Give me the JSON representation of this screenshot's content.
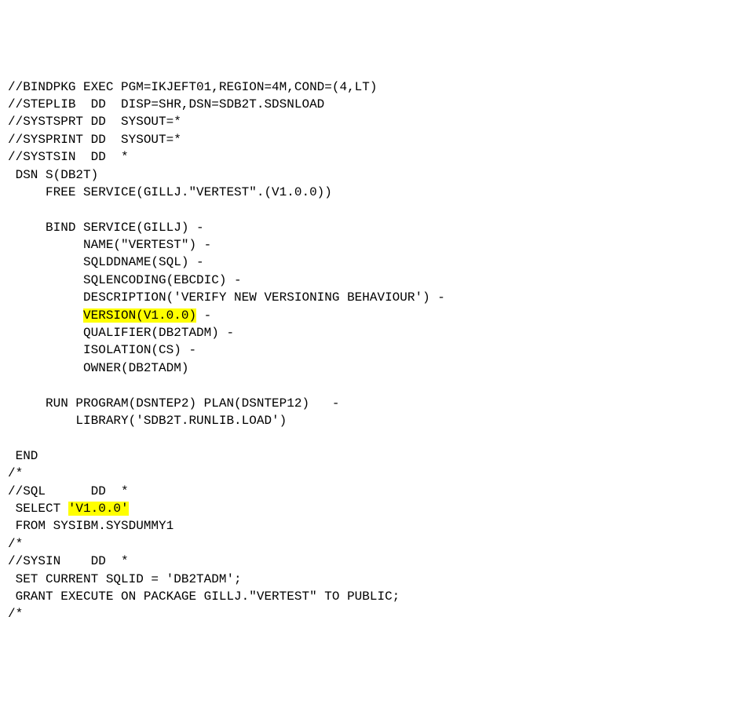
{
  "lines": {
    "l1": "//BINDPKG EXEC PGM=IKJEFT01,REGION=4M,COND=(4,LT)",
    "l2": "//STEPLIB  DD  DISP=SHR,DSN=SDB2T.SDSNLOAD",
    "l3": "//SYSTSPRT DD  SYSOUT=*",
    "l4": "//SYSPRINT DD  SYSOUT=*",
    "l5": "//SYSTSIN  DD  *",
    "l6": " DSN S(DB2T)",
    "l7": "     FREE SERVICE(GILLJ.\"VERTEST\".(V1.0.0))",
    "l8": "",
    "l9": "     BIND SERVICE(GILLJ) -",
    "l10": "          NAME(\"VERTEST\") -",
    "l11": "          SQLDDNAME(SQL) -",
    "l12": "          SQLENCODING(EBCDIC) -",
    "l13": "          DESCRIPTION('VERIFY NEW VERSIONING BEHAVIOUR') -",
    "l14a": "          ",
    "l14b": "VERSION(V1.0.0)",
    "l14c": " -",
    "l15": "          QUALIFIER(DB2TADM) -",
    "l16": "          ISOLATION(CS) -",
    "l17": "          OWNER(DB2TADM)",
    "l18": "",
    "l19": "     RUN PROGRAM(DSNTEP2) PLAN(DSNTEP12)   -",
    "l20": "         LIBRARY('SDB2T.RUNLIB.LOAD')",
    "l21": "",
    "l22": " END",
    "l23": "/*",
    "l24": "//SQL      DD  *",
    "l25a": " SELECT ",
    "l25b": "'V1.0.0'",
    "l26": " FROM SYSIBM.SYSDUMMY1",
    "l27": "/*",
    "l28": "//SYSIN    DD  *",
    "l29": " SET CURRENT SQLID = 'DB2TADM';",
    "l30": " GRANT EXECUTE ON PACKAGE GILLJ.\"VERTEST\" TO PUBLIC;",
    "l31": "/*"
  }
}
